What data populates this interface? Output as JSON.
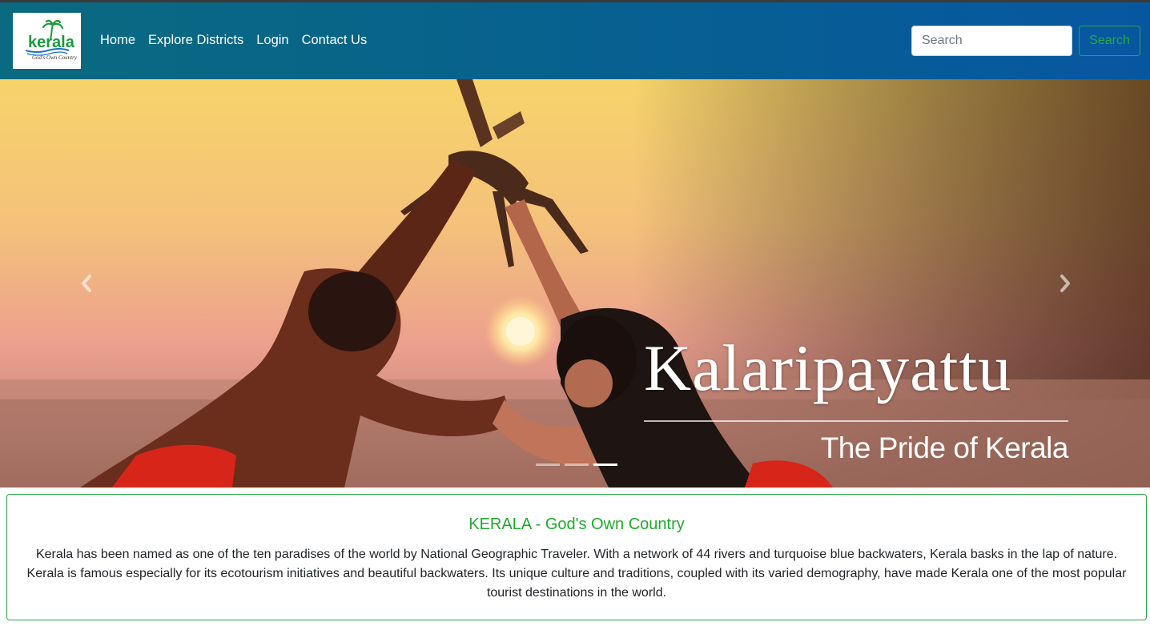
{
  "header": {
    "logo": {
      "text": "kerala",
      "tagline": "God's Own Country"
    },
    "nav": [
      {
        "label": "Home"
      },
      {
        "label": "Explore Districts"
      },
      {
        "label": "Login"
      },
      {
        "label": "Contact Us"
      }
    ],
    "search": {
      "placeholder": "Search",
      "value": "",
      "button_label": "Search"
    }
  },
  "carousel": {
    "caption_title": "Kalaripayattu",
    "caption_subtitle": "The Pride of Kerala",
    "slide_count": 3,
    "active_slide": 3,
    "prev_icon": "chevron-left-icon",
    "next_icon": "chevron-right-icon"
  },
  "about": {
    "title": "KERALA - God's Own Country",
    "text": "Kerala has been named as one of the ten paradises of the world by National Geographic Traveler. With a network of 44 rivers and turquoise blue backwaters, Kerala basks in the lap of nature. Kerala is famous especially for its ecotourism initiatives and beautiful backwaters. Its unique culture and traditions, coupled with its varied demography, have made Kerala one of the most popular tourist destinations in the world."
  },
  "colors": {
    "navbar_start": "#0a6a7f",
    "navbar_end": "#0757a0",
    "accent_green": "#28a745",
    "title_green": "#1eab2a"
  }
}
